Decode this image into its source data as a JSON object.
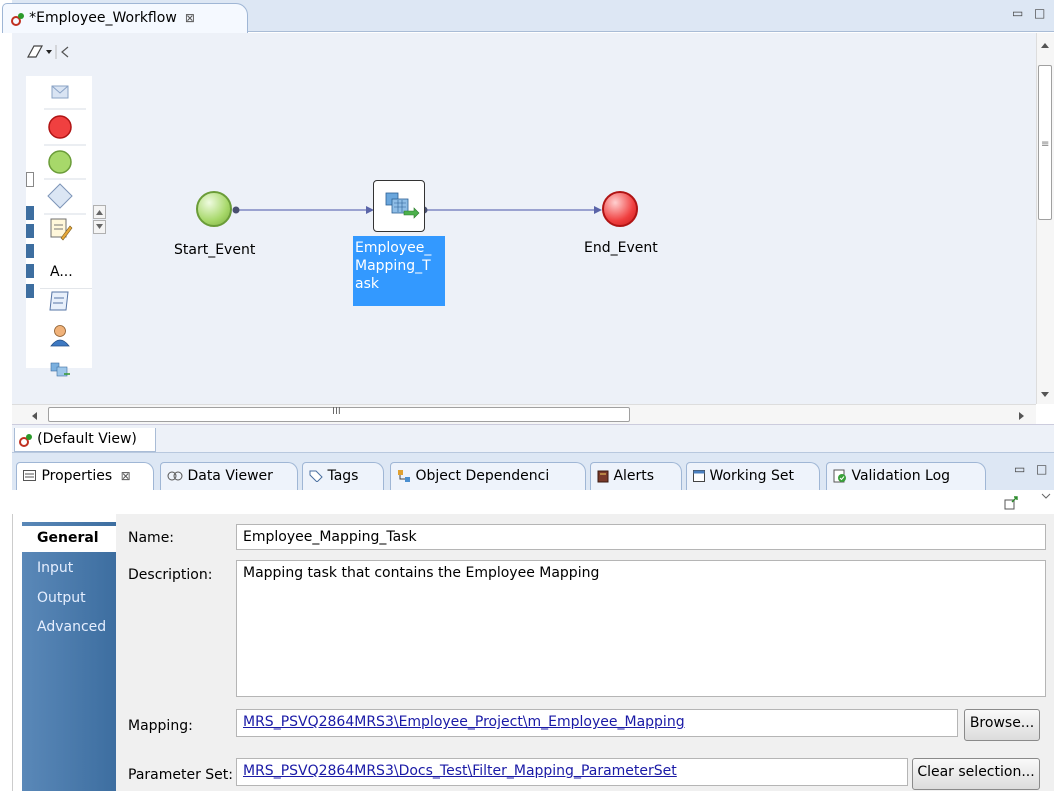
{
  "editor": {
    "tab_title": "*Employee_Workflow",
    "close_glyph": "⊠",
    "minimize_glyph": "▭",
    "maximize_glyph": "□"
  },
  "palette": {
    "items": [
      {
        "name": "notification-task-icon"
      },
      {
        "name": "end-event-icon"
      },
      {
        "name": "start-event-icon"
      },
      {
        "name": "gateway-icon"
      },
      {
        "name": "assignment-task-icon"
      },
      {
        "name": "command-task-icon"
      },
      {
        "name": "human-task-icon"
      },
      {
        "name": "mapping-task-icon"
      }
    ],
    "assignment_label": "A..."
  },
  "workflow": {
    "start_label": "Start_Event",
    "task_label": "Employee_ Mapping_T ask",
    "end_label": "End_Event",
    "start_color": "#a7d86a",
    "end_color": "#f04040",
    "selection_color": "#3399ff"
  },
  "canvas": {
    "hscroll_thumb_text": "III",
    "view_tab": "(Default View)"
  },
  "properties": {
    "tabs": [
      {
        "label": "Properties",
        "icon": "properties-icon",
        "active": true
      },
      {
        "label": "Data Viewer",
        "icon": "data-viewer-icon"
      },
      {
        "label": "Tags",
        "icon": "tag-icon"
      },
      {
        "label": "Object Dependenci",
        "icon": "dependencies-icon"
      },
      {
        "label": "Alerts",
        "icon": "alerts-icon"
      },
      {
        "label": "Working Set",
        "icon": "working-set-icon"
      },
      {
        "label": "Validation Log",
        "icon": "validation-log-icon"
      }
    ],
    "nav": [
      "General",
      "Input",
      "Output",
      "Advanced"
    ],
    "name_label": "Name:",
    "name_value": "Employee_Mapping_Task",
    "description_label": "Description:",
    "description_value": "Mapping task that contains the Employee Mapping",
    "mapping_label": "Mapping:",
    "mapping_value": "MRS_PSVQ2864MRS3\\Employee_Project\\m_Employee_Mapping",
    "browse_button": "Browse...",
    "parameter_set_label": "Parameter Set:",
    "parameter_set_value": "MRS_PSVQ2864MRS3\\Docs_Test\\Filter_Mapping_ParameterSet",
    "clear_button": "Clear selection..."
  }
}
